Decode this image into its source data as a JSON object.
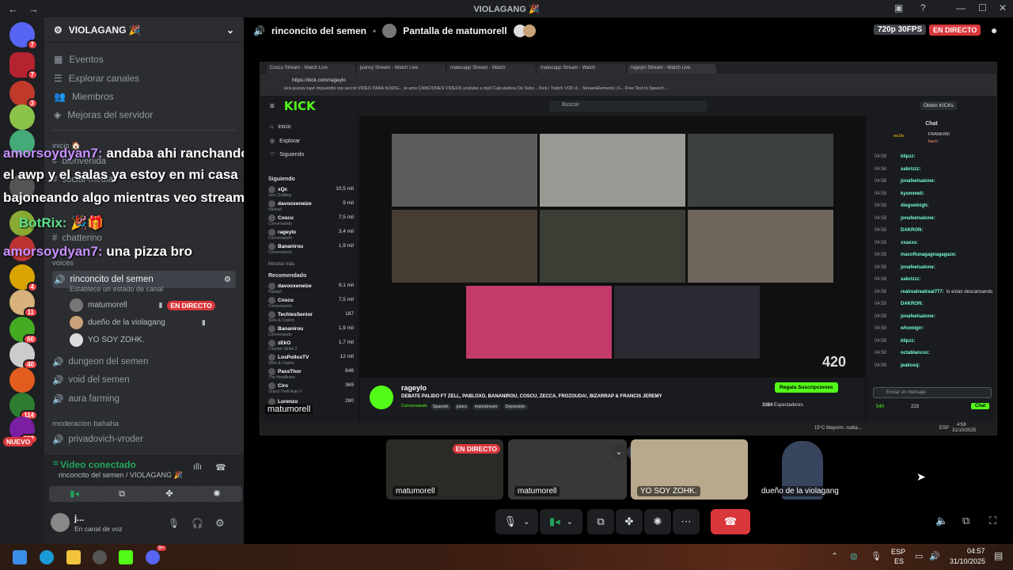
{
  "window": {
    "title": "VIOLAGANG 🎉"
  },
  "rail": {
    "badges": [
      "7",
      "7",
      "3",
      "4",
      "11",
      "60",
      "40",
      "114",
      "397"
    ],
    "new_label": "NUEVO"
  },
  "sidebar": {
    "server_name": "VIOLAGANG 🎉",
    "nav": [
      "Eventos",
      "Explorar canales",
      "Miembros",
      "Mejoras del servidor"
    ],
    "cat_inicio": "inicio 🏠",
    "ch_bienvenida": "bienvenida",
    "ch_social": "social-media",
    "ch_chatterino": "chatterino",
    "cat_voices": "voices",
    "voice_selected": "rinconcito del semen",
    "voice_status": "Establece un estado de canal",
    "voice_users": [
      {
        "name": "matumorell",
        "live": "EN DIRECTO"
      },
      {
        "name": "dueño de la violagang"
      },
      {
        "name": "YO SOY ZOHK."
      }
    ],
    "voice_channels": [
      "dungeon del semen",
      "void del semen",
      "aura farming"
    ],
    "cat_moderacion": "moderacion bahaha",
    "ch_privado": "privadovich-vroder"
  },
  "overlay_chat": [
    {
      "name": "amorsoydyan7:",
      "text": " andaba ahi ranchando"
    },
    {
      "name": "",
      "text": "el awp y el salas ya estoy en mi casa"
    },
    {
      "name": "",
      "text": "bajoneando algo mientras veo streamers"
    },
    {
      "name": "BotRix:",
      "text": " 🎉🎁"
    },
    {
      "name": "amorsoydyan7:",
      "text": " una pizza bro"
    }
  ],
  "voice_panel": {
    "status": "Video conectado",
    "location": "rinconcito del semen / VIOLAGANG 🎉",
    "user": "j...",
    "user_status": "En canal de voz"
  },
  "stage": {
    "channel": "rinconcito del semen",
    "screen_label": "Pantalla de matumorell",
    "quality": "720p 30FPS",
    "live": "EN DIRECTO"
  },
  "browser": {
    "tabs": [
      "Coscu Stream - Watch Live",
      "jeansy Stream - Watch Live",
      "matecapp Stream - Watch",
      "matecapp Stream - Watch",
      "rageylo Stream - Watch Live"
    ],
    "url": "https://kick.com/rageylo",
    "bookmarks": "kick  jeansy  tupé  impuestito  top secret  VIDEO PARA KODIG...  te amo  CANCIONES VIDEOS  youtube a mp3  Calculadora De Subs...  Kick / Twitch VOD d...  StreamElements | F...  Free Text to Speech..."
  },
  "kick": {
    "search_placeholder": "Buscar",
    "get_kicks": "Obtén KICKs",
    "nav": [
      "Inicio",
      "Explorar",
      "Siguiendo"
    ],
    "following_label": "Siguiendo",
    "following": [
      {
        "name": "xQc",
        "sub": "Just Chatting",
        "count": "10,5 mil"
      },
      {
        "name": "davooxeneize",
        "sub": "Haxball",
        "count": "9 mil"
      },
      {
        "name": "Coscu",
        "sub": "Conversando",
        "count": "7,5 mil"
      },
      {
        "name": "rageylo",
        "sub": "Conversando",
        "count": "3,4 mil"
      },
      {
        "name": "Bananirou",
        "sub": "Conversando",
        "count": "1,9 mil"
      }
    ],
    "show_more": "Mostrar más",
    "recommended_label": "Recomendado",
    "recommended": [
      {
        "name": "davooxeneize",
        "sub": "Haxball",
        "count": "9,1 mil"
      },
      {
        "name": "Coscu",
        "sub": "Conversando",
        "count": "7,5 mil"
      },
      {
        "name": "TechiesSenior",
        "sub": "Slots & Casino",
        "count": "187"
      },
      {
        "name": "Bananirou",
        "sub": "Conversando",
        "count": "1,9 mil"
      },
      {
        "name": "zEkO",
        "sub": "Counter-Strike 2",
        "count": "1,7 mil"
      },
      {
        "name": "LosPollosTV",
        "sub": "Slots & Casino",
        "count": "12 mil"
      },
      {
        "name": "PassThor",
        "sub": "The Headliners",
        "count": "846"
      },
      {
        "name": "Ciro",
        "sub": "Grand Theft Auto V",
        "count": "369"
      },
      {
        "name": "Lorenzo",
        "sub": "",
        "count": "280"
      }
    ],
    "streamer": "rageylo",
    "stream_title": "DEBATE PALIDO FT ZELL, PABLOXO, BANANIROU, COSCU, ZECCA, FROZOUDA!, BIZARRAP & FRANCIS JEREMY",
    "tags": [
      "Conversando",
      "Spanish",
      "joseo",
      "mainstream",
      "Depresión"
    ],
    "subscribe": "Regala Suscripciones",
    "viewers": "3384",
    "viewers_label": "Espectadores",
    "corner_badge": "420",
    "chat_title": "Chat",
    "chat_top": [
      "os1lo",
      "FRANKIWI",
      "barxi"
    ],
    "chat_lines": [
      {
        "t": "04:58",
        "u": "klipzz:"
      },
      {
        "t": "04:58",
        "u": "sabrizzz:"
      },
      {
        "t": "04:58",
        "u": "jonafeelsalone:"
      },
      {
        "t": "04:58",
        "u": "kyommeli:"
      },
      {
        "t": "04:58",
        "u": "diegoelnigh:"
      },
      {
        "t": "04:58",
        "u": "jonafeelsalone:"
      },
      {
        "t": "04:58",
        "u": "DAKRON:"
      },
      {
        "t": "04:58",
        "u": "xxaxxx:"
      },
      {
        "t": "04:58",
        "u": "macoflunagagnagagazo:"
      },
      {
        "t": "04:58",
        "u": "jonafeelsalone:"
      },
      {
        "t": "04:58",
        "u": "sabrizzz:"
      },
      {
        "t": "04:58",
        "u": "realrealrealreal777:",
        "m": "lo estan descansando"
      },
      {
        "t": "04:58",
        "u": "DAKRON:"
      },
      {
        "t": "04:58",
        "u": "jonafeelsalone:"
      },
      {
        "t": "04:58",
        "u": "whomigrr:"
      },
      {
        "t": "04:58",
        "u": "klipzz:"
      },
      {
        "t": "04:58",
        "u": "octablancoz:"
      },
      {
        "t": "04:58",
        "u": "jeakosq:"
      }
    ],
    "chat_placeholder": "Enviar un mensaje",
    "chat_points": "540",
    "chat_kicks": "223",
    "chat_button": "Chat",
    "overlay_name": "matumorell"
  },
  "taskbar_mini": {
    "weather": "15°C  Mayorm. nubla...",
    "lang": "ESP",
    "time": "4:58",
    "date": "31/10/2025"
  },
  "tiles": [
    {
      "label": "matumorell",
      "live": "EN DIRECTO"
    },
    {
      "label": "matumorell"
    },
    {
      "label": "YO SOY ZOHK."
    },
    {
      "label": "dueño de la violagang"
    }
  ],
  "taskbar": {
    "lang1": "ESP",
    "lang2": "ES",
    "time": "04:57",
    "date": "31/10/2025",
    "badge": "9+"
  }
}
